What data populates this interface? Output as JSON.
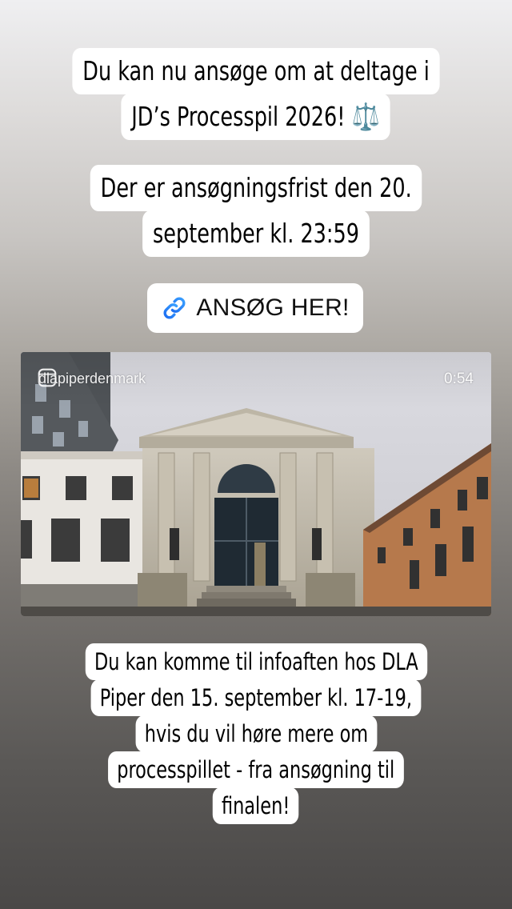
{
  "story": {
    "headline_lines": [
      "Du kan nu ansøge om at deltage i",
      "JD’s Processpil 2026! ⚖️"
    ],
    "deadline_lines": [
      "Der er ansøgningsfrist den 20.",
      "september kl. 23:59"
    ],
    "link_sticker": {
      "label": "ANSØG HER!",
      "icon": "link-icon"
    },
    "video_post": {
      "account_handle": "dlapiperdenmark",
      "duration": "0:54",
      "icon": "reel-icon"
    },
    "info_lines": [
      "Du kan komme til infoaften hos DLA",
      "Piper den 15. september kl. 17-19,",
      "hvis du vil høre mere om",
      "processpillet - fra ansøgning til",
      "finalen!"
    ]
  }
}
